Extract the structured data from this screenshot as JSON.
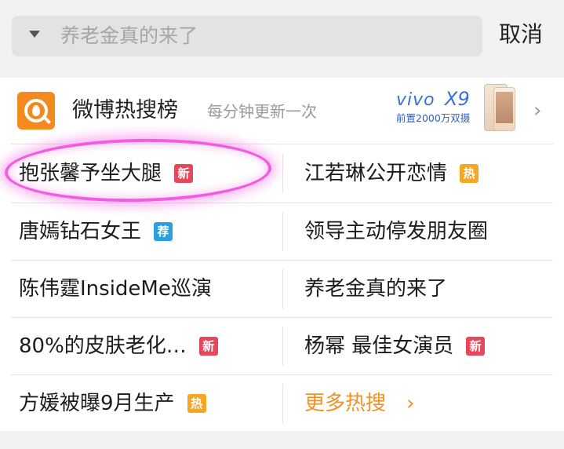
{
  "search": {
    "query": "养老金真的来了",
    "cancel_label": "取消"
  },
  "board": {
    "title": "微博热搜榜",
    "subtitle": "每分钟更新一次",
    "ad": {
      "brand": "vivo",
      "model": "X9",
      "caption": "前置2000万双摄"
    }
  },
  "colors": {
    "new_badge": "#e7475d",
    "hot_badge": "#f5a623",
    "rec_badge": "#2aa0e0",
    "more_link": "#f0922b",
    "highlight_circle": "#f25ce0"
  },
  "items": [
    {
      "text": "抱张馨予坐大腿",
      "badge": "新"
    },
    {
      "text": "江若琳公开恋情",
      "badge": "热"
    },
    {
      "text": "唐嫣钻石女王",
      "badge": "荐"
    },
    {
      "text": "领导主动停发朋友圈",
      "badge": ""
    },
    {
      "text": "陈伟霆InsideMe巡演",
      "badge": ""
    },
    {
      "text": "养老金真的来了",
      "badge": ""
    },
    {
      "text": "80%的皮肤老化…",
      "badge": "新"
    },
    {
      "text": "杨幂 最佳女演员",
      "badge": "新"
    },
    {
      "text": "方媛被曝9月生产",
      "badge": "热"
    }
  ],
  "more": {
    "label": "更多热搜",
    "icon": "chevron-right-icon"
  }
}
